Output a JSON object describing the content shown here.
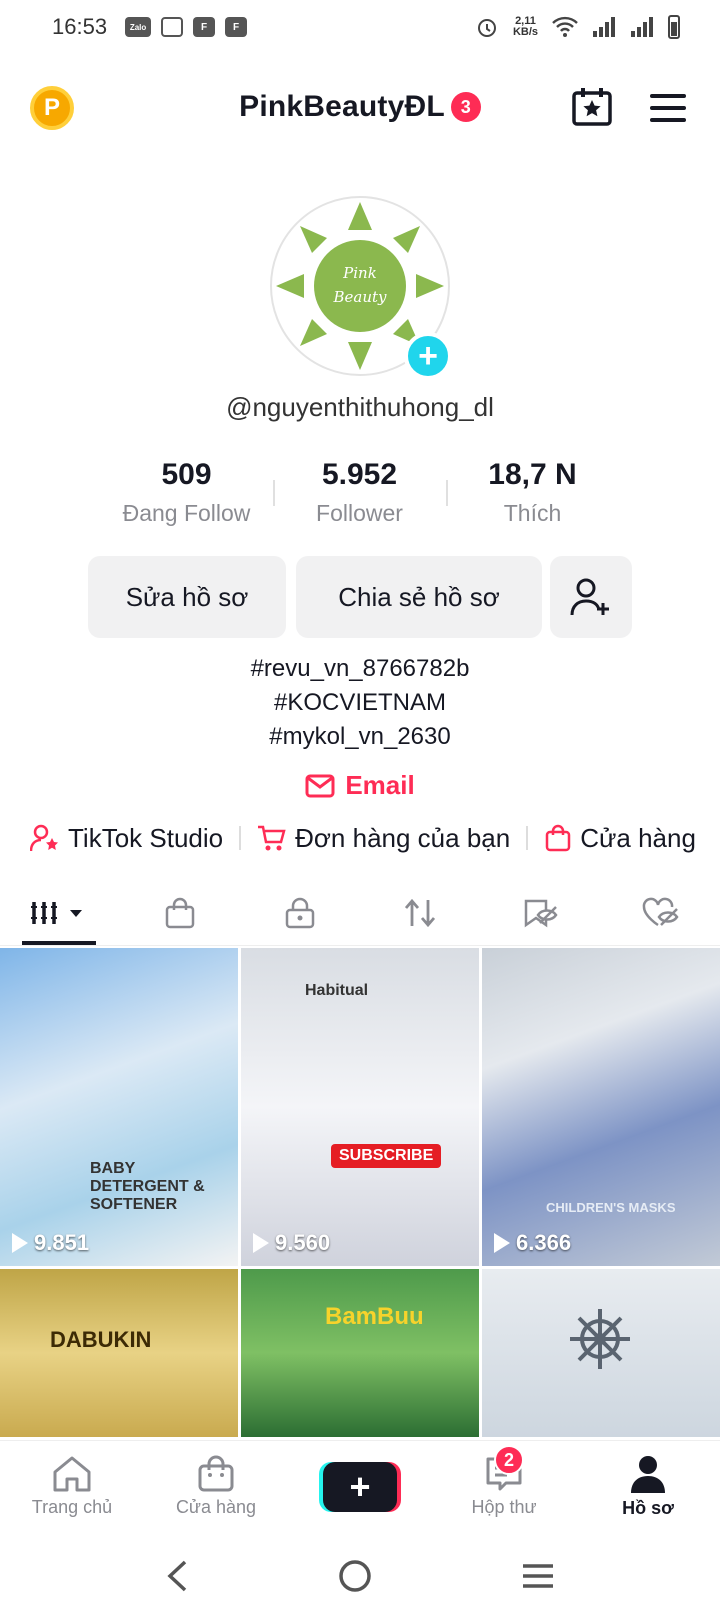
{
  "status_bar": {
    "time": "16:53",
    "left_icons": [
      "Zalo",
      "chat-icon",
      "F",
      "F"
    ],
    "speed_value": "2,11",
    "speed_unit": "KB/s"
  },
  "header": {
    "account_name": "PinkBeautyĐL",
    "notification_count": "3",
    "coin_letter": "P"
  },
  "avatar": {
    "text_line1": "Pink",
    "text_line2": "Beauty"
  },
  "profile": {
    "handle": "@nguyenthithuhong_dl",
    "stats": [
      {
        "value": "509",
        "label": "Đang Follow"
      },
      {
        "value": "5.952",
        "label": "Follower"
      },
      {
        "value": "18,7 N",
        "label": "Thích"
      }
    ],
    "edit_label": "Sửa hồ sơ",
    "share_label": "Chia sẻ hồ sơ",
    "bio_lines": [
      "#revu_vn_8766782b",
      "#KOCVIETNAM",
      "#mykol_vn_2630"
    ],
    "email_label": "Email"
  },
  "shortcuts": [
    {
      "label": "TikTok Studio"
    },
    {
      "label": "Đơn hàng của bạn"
    },
    {
      "label": "Cửa hàng"
    }
  ],
  "videos": [
    {
      "views": "9.851",
      "overlay": "BABY DETERGENT & SOFTENER"
    },
    {
      "views": "9.560",
      "overlay": "SUBSCRIBE",
      "brand": "Habitual"
    },
    {
      "views": "6.366",
      "overlay": "CHILDREN'S MASKS"
    },
    {
      "views": "",
      "overlay": "DABUKIN"
    },
    {
      "views": "",
      "overlay": "BamBuu"
    },
    {
      "views": "",
      "overlay": ""
    }
  ],
  "bottom_nav": {
    "home": "Trang chủ",
    "shop": "Cửa hàng",
    "inbox": "Hộp thư",
    "inbox_badge": "2",
    "profile": "Hồ sơ"
  },
  "colors": {
    "accent": "#fe2c55",
    "cyan": "#25f4ee",
    "add_avatar": "#20d5ec",
    "avatar_green": "#8bb84e"
  }
}
